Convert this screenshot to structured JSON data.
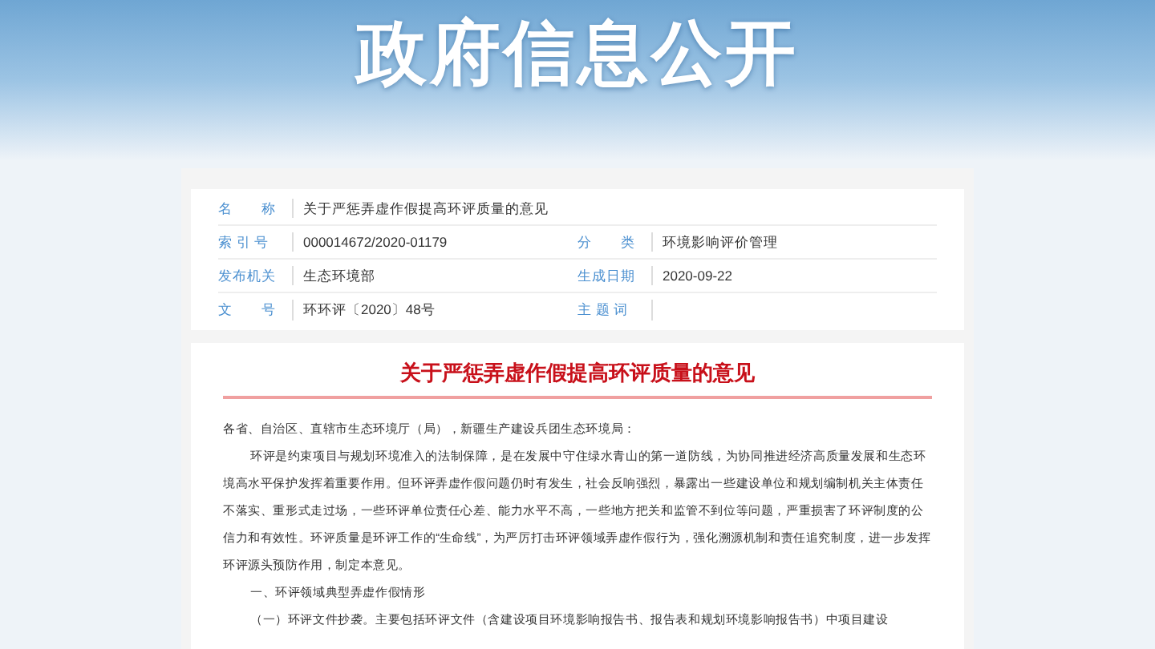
{
  "banner": {
    "title": "政府信息公开"
  },
  "info": {
    "rows": [
      {
        "fields": [
          {
            "label": "名　　称",
            "value": "关于严惩弄虚作假提高环评质量的意见"
          }
        ]
      },
      {
        "fields": [
          {
            "label": "索 引 号",
            "value": "000014672/2020-01179"
          },
          {
            "label": "分　　类",
            "value": "环境影响评价管理"
          }
        ]
      },
      {
        "fields": [
          {
            "label": "发布机关",
            "value": "生态环境部"
          },
          {
            "label": "生成日期",
            "value": "2020-09-22"
          }
        ]
      },
      {
        "fields": [
          {
            "label": "文　　号",
            "value": "环环评〔2020〕48号"
          },
          {
            "label": "主 题 词"
          }
        ]
      }
    ]
  },
  "document": {
    "title": "关于严惩弄虚作假提高环评质量的意见",
    "paragraphs": [
      {
        "kind": "salutation",
        "text": "各省、自治区、直辖市生态环境厅（局），新疆生产建设兵团生态环境局："
      },
      {
        "kind": "body",
        "text": "环评是约束项目与规划环境准入的法制保障，是在发展中守住绿水青山的第一道防线，为协同推进经济高质量发展和生态环境高水平保护发挥着重要作用。但环评弄虚作假问题仍时有发生，社会反响强烈，暴露出一些建设单位和规划编制机关主体责任不落实、重形式走过场，一些环评单位责任心差、能力水平不高，一些地方把关和监管不到位等问题，严重损害了环评制度的公信力和有效性。环评质量是环评工作的“生命线”，为严厉打击环评领域弄虚作假行为，强化溯源机制和责任追究制度，进一步发挥环评源头预防作用，制定本意见。"
      },
      {
        "kind": "heading",
        "text": "一、环评领域典型弄虚作假情形"
      },
      {
        "kind": "body",
        "text": "（一）环评文件抄袭。主要包括环评文件（含建设项目环境影响报告书、报告表和规划环境影响报告书）中项目建设"
      }
    ]
  }
}
